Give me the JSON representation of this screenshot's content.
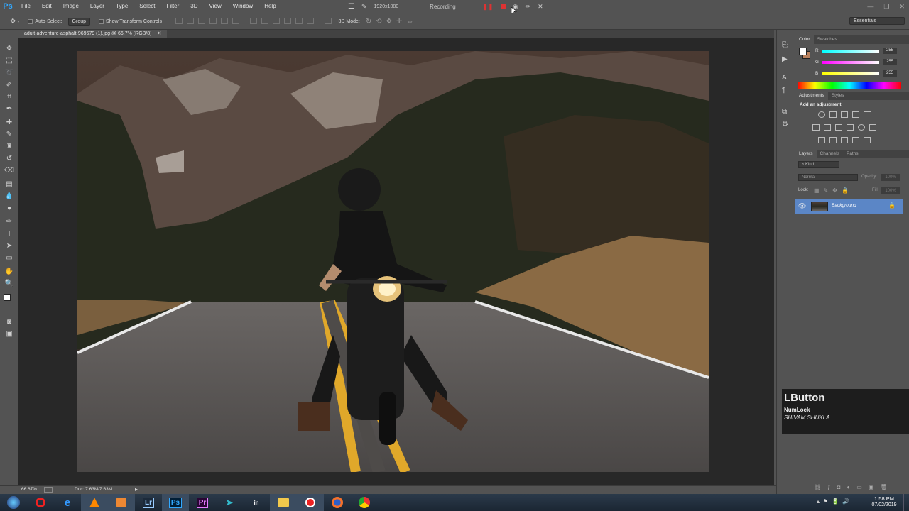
{
  "app": {
    "logo": "Ps"
  },
  "menu": [
    "File",
    "Edit",
    "Image",
    "Layer",
    "Type",
    "Select",
    "Filter",
    "3D",
    "View",
    "Window",
    "Help"
  ],
  "recorder": {
    "resolution": "1920x1080",
    "status": "Recording"
  },
  "options": {
    "auto_select_label": "Auto-Select:",
    "auto_select_value": "Group",
    "transform_label": "Show Transform Controls",
    "mode_3d_label": "3D Mode:",
    "workspace": "Essentials"
  },
  "document": {
    "tab_title": "adult-adventure-asphalt-969679 (1).jpg @ 66.7% (RGB/8)"
  },
  "color_panel": {
    "tabs": [
      "Color",
      "Swatches"
    ],
    "channels": [
      {
        "label": "R",
        "value": "255",
        "color": "#ff3030"
      },
      {
        "label": "G",
        "value": "255",
        "color": "#30ff30"
      },
      {
        "label": "B",
        "value": "255",
        "color": "#3060ff"
      }
    ]
  },
  "adjustments_panel": {
    "tabs": [
      "Adjustments",
      "Styles"
    ],
    "hint": "Add an adjustment"
  },
  "layers_panel": {
    "tabs": [
      "Layers",
      "Channels",
      "Paths"
    ],
    "filter": "Kind",
    "blend_mode": "Normal",
    "opacity_label": "Opacity:",
    "opacity_value": "100%",
    "lock_label": "Lock:",
    "fill_label": "Fill:",
    "fill_value": "100%",
    "layers": [
      {
        "name": "Background"
      }
    ]
  },
  "status": {
    "zoom": "66.67%",
    "doc_size": "Doc: 7.63M/7.63M"
  },
  "key_overlay": {
    "key": "LButton",
    "lock": "NumLock",
    "user": "SHIVAM SHUKLA"
  },
  "taskbar": {
    "time": "1:58 PM",
    "date": "07/02/2019",
    "apps": [
      "start",
      "opera-icon",
      "edge-icon",
      "vlc-icon",
      "media-player-icon",
      "Lr",
      "Ps",
      "Pr",
      "kodi-icon",
      "inshot-icon",
      "file-explorer-icon",
      "record-icon",
      "firefox-icon",
      "chrome-icon"
    ]
  }
}
